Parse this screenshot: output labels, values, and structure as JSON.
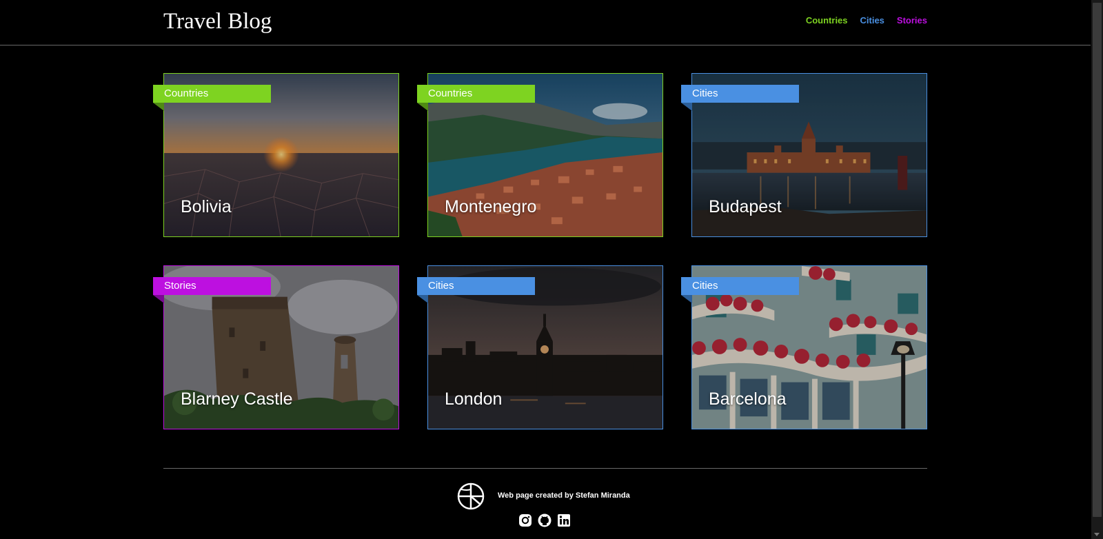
{
  "header": {
    "title": "Travel Blog",
    "nav": [
      {
        "label": "Countries",
        "color": "#7ed321"
      },
      {
        "label": "Cities",
        "color": "#4a90e2"
      },
      {
        "label": "Stories",
        "color": "#bd10e0"
      }
    ]
  },
  "colors": {
    "countries": "#7ed321",
    "cities": "#4a90e2",
    "stories": "#bd10e0"
  },
  "cards": [
    {
      "category": "Countries",
      "title": "Bolivia",
      "image": "salt-flat-sunset-image"
    },
    {
      "category": "Countries",
      "title": "Montenegro",
      "image": "bay-of-kotor-image"
    },
    {
      "category": "Cities",
      "title": "Budapest",
      "image": "parliament-night-image"
    },
    {
      "category": "Stories",
      "title": "Blarney Castle",
      "image": "castle-tower-image"
    },
    {
      "category": "Cities",
      "title": "London",
      "image": "big-ben-skyline-image"
    },
    {
      "category": "Cities",
      "title": "Barcelona",
      "image": "casa-batllo-facade-image"
    }
  ],
  "footer": {
    "credit": "Web page created by Stefan Miranda",
    "social": [
      "instagram-icon",
      "github-icon",
      "linkedin-icon"
    ]
  }
}
